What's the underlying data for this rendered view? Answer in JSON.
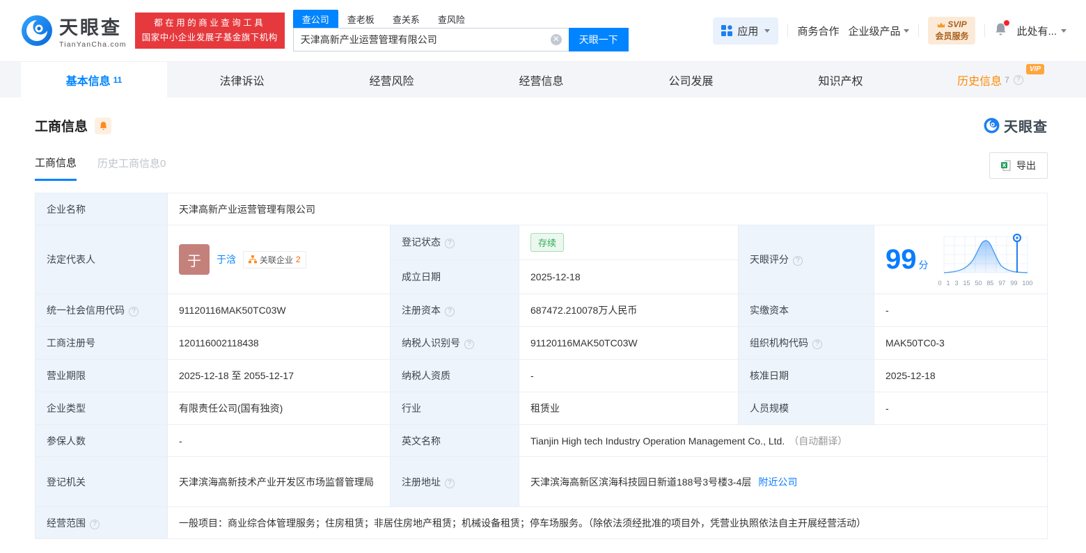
{
  "header": {
    "logo_text": "天眼查",
    "logo_sub": "TianYanCha.com",
    "slogan_line1": "都在用的商业查询工具",
    "slogan_line2": "国家中小企业发展子基金旗下机构",
    "search": {
      "tabs": [
        "查公司",
        "查老板",
        "查关系",
        "查风险"
      ],
      "value": "天津高新产业运营管理有限公司",
      "button": "天眼一下"
    },
    "apps_label": "应用",
    "nav_business": "商务合作",
    "nav_enterprise": "企业级产品",
    "svip_line1": "SVIP",
    "svip_line2": "会员服务",
    "user_label": "此处有..."
  },
  "tabs": {
    "vip_label": "VIP",
    "items": [
      {
        "label": "基本信息",
        "count": "11"
      },
      {
        "label": "法律诉讼"
      },
      {
        "label": "经营风险"
      },
      {
        "label": "经营信息"
      },
      {
        "label": "公司发展"
      },
      {
        "label": "知识产权"
      },
      {
        "label": "历史信息",
        "count": "7"
      }
    ]
  },
  "section": {
    "title": "工商信息",
    "subtab_active": "工商信息",
    "subtab_history": "历史工商信息",
    "subtab_history_count": "0",
    "watermark": "天眼查",
    "export_label": "导出"
  },
  "fields": {
    "company_name": {
      "label": "企业名称",
      "value": "天津高新产业运营管理有限公司"
    },
    "legal_rep": {
      "label": "法定代表人",
      "name": "于浛",
      "avatar_char": "于",
      "related_label": "关联企业",
      "related_count": "2"
    },
    "reg_status": {
      "label": "登记状态",
      "value": "存续"
    },
    "establish_date": {
      "label": "成立日期",
      "value": "2025-12-18"
    },
    "score": {
      "label": "天眼评分",
      "value": "99",
      "unit": "分",
      "axis": [
        "0",
        "1",
        "3",
        "15",
        "50",
        "85",
        "97",
        "99",
        "100"
      ]
    },
    "credit_code": {
      "label": "统一社会信用代码",
      "value": "91120116MAK50TC03W"
    },
    "reg_capital": {
      "label": "注册资本",
      "value": "687472.210078万人民币"
    },
    "paid_capital": {
      "label": "实缴资本",
      "value": "-"
    },
    "reg_number": {
      "label": "工商注册号",
      "value": "120116002118438"
    },
    "taxpayer_id": {
      "label": "纳税人识别号",
      "value": "91120116MAK50TC03W"
    },
    "org_code": {
      "label": "组织机构代码",
      "value": "MAK50TC0-3"
    },
    "business_term": {
      "label": "营业期限",
      "value": "2025-12-18 至 2055-12-17"
    },
    "taxpayer_quality": {
      "label": "纳税人资质",
      "value": "-"
    },
    "approval_date": {
      "label": "核准日期",
      "value": "2025-12-18"
    },
    "company_type": {
      "label": "企业类型",
      "value": "有限责任公司(国有独资)"
    },
    "industry": {
      "label": "行业",
      "value": "租赁业"
    },
    "staff_size": {
      "label": "人员规模",
      "value": "-"
    },
    "insured_count": {
      "label": "参保人数",
      "value": "-"
    },
    "english_name": {
      "label": "英文名称",
      "value": "Tianjin High tech Industry Operation Management Co., Ltd.",
      "note": "（自动翻译）"
    },
    "reg_authority": {
      "label": "登记机关",
      "value": "天津滨海高新技术产业开发区市场监督管理局"
    },
    "reg_address": {
      "label": "注册地址",
      "value": "天津滨海高新区滨海科技园日新道188号3号楼3-4层",
      "link": "附近公司"
    },
    "business_scope": {
      "label": "经营范围",
      "value": "一般项目：商业综合体管理服务；住房租赁；非居住房地产租赁；机械设备租赁；停车场服务。（除依法须经批准的项目外，凭营业执照依法自主开展经营活动）"
    }
  }
}
